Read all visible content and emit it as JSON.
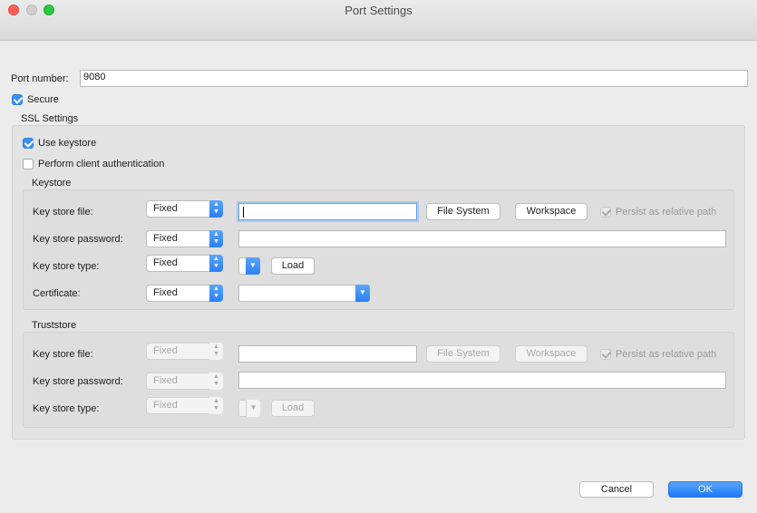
{
  "window": {
    "title": "Port Settings"
  },
  "port": {
    "label": "Port number:",
    "value": "9080"
  },
  "secure": {
    "label": "Secure",
    "checked": true
  },
  "ssl": {
    "title": "SSL Settings",
    "use_keystore": {
      "label": "Use keystore",
      "checked": true
    },
    "client_auth": {
      "label": "Perform client authentication",
      "checked": false
    }
  },
  "keystore": {
    "title": "Keystore",
    "file_label": "Key store file:",
    "file_mode": "Fixed",
    "file_value": "",
    "file_system_button": "File System",
    "workspace_button": "Workspace",
    "persist_label": "Persist as relative path",
    "password_label": "Key store password:",
    "password_mode": "Fixed",
    "type_label": "Key store type:",
    "type_mode": "Fixed",
    "load_button": "Load",
    "certificate_label": "Certificate:",
    "certificate_mode": "Fixed"
  },
  "truststore": {
    "title": "Truststore",
    "file_label": "Key store file:",
    "file_mode": "Fixed",
    "file_system_button": "File System",
    "workspace_button": "Workspace",
    "persist_label": "Persist as relative path",
    "password_label": "Key store password:",
    "password_mode": "Fixed",
    "type_label": "Key store type:",
    "type_mode": "Fixed",
    "load_button": "Load"
  },
  "footer": {
    "cancel": "Cancel",
    "ok": "OK"
  },
  "colors": {
    "accent": "#2b7ff5",
    "window_bg": "#ececec"
  },
  "icons": [
    "close-light",
    "minimize-light",
    "zoom-light",
    "checkmark-icon",
    "popup-arrows-icon",
    "chevron-down-icon"
  ]
}
